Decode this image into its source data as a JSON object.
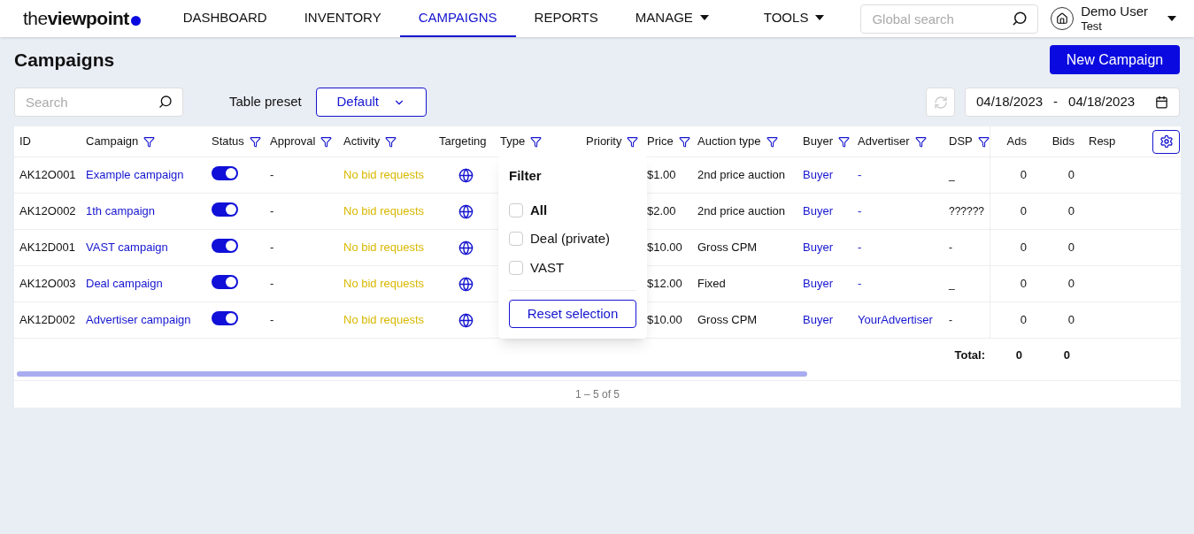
{
  "logo": {
    "light": "the",
    "bold": "viewpoint"
  },
  "nav": [
    {
      "label": "DASHBOARD",
      "selected": false,
      "has_menu": false
    },
    {
      "label": "INVENTORY",
      "selected": false,
      "has_menu": false
    },
    {
      "label": "CAMPAIGNS",
      "selected": true,
      "has_menu": false
    },
    {
      "label": "REPORTS",
      "selected": false,
      "has_menu": false
    },
    {
      "label": "MANAGE",
      "selected": false,
      "has_menu": true
    },
    {
      "label": "TOOLS",
      "selected": false,
      "has_menu": true
    }
  ],
  "global_search": {
    "placeholder": "Global search"
  },
  "user": {
    "name": "Demo User",
    "account": "Test"
  },
  "page_title": "Campaigns",
  "new_button": "New Campaign",
  "search": {
    "placeholder": "Search"
  },
  "preset": {
    "label": "Table preset",
    "value": "Default"
  },
  "date_range": {
    "from": "04/18/2023",
    "separator": "-",
    "to": "04/18/2023"
  },
  "columns": [
    {
      "label": "ID",
      "filter": false
    },
    {
      "label": "Campaign",
      "filter": true
    },
    {
      "label": "Status",
      "filter": true
    },
    {
      "label": "Approval",
      "filter": true
    },
    {
      "label": "Activity",
      "filter": true
    },
    {
      "label": "Targeting",
      "filter": false
    },
    {
      "label": "Type",
      "filter": true
    },
    {
      "label": "Priority",
      "filter": true
    },
    {
      "label": "Price",
      "filter": true
    },
    {
      "label": "Auction type",
      "filter": true
    },
    {
      "label": "Buyer",
      "filter": true
    },
    {
      "label": "Advertiser",
      "filter": true
    },
    {
      "label": "DSP",
      "filter": true
    },
    {
      "label": "Ads",
      "filter": false
    },
    {
      "label": "Bids",
      "filter": false
    },
    {
      "label": "Resp",
      "filter": false
    }
  ],
  "rows": [
    {
      "id": "AK12O001",
      "campaign": "Example campaign",
      "on": true,
      "approval": "-",
      "activity": "No bid requests",
      "price": "$1.00",
      "auction_type": "2nd price auction",
      "buyer": "Buyer",
      "advertiser": "-",
      "dsp": "_",
      "ads": "0",
      "bids": "0"
    },
    {
      "id": "AK12O002",
      "campaign": "1th campaign",
      "on": true,
      "approval": "-",
      "activity": "No bid requests",
      "price": "$2.00",
      "auction_type": "2nd price auction",
      "buyer": "Buyer",
      "advertiser": "-",
      "dsp": "??????",
      "ads": "0",
      "bids": "0"
    },
    {
      "id": "AK12D001",
      "campaign": "VAST campaign",
      "on": true,
      "approval": "-",
      "activity": "No bid requests",
      "price": "$10.00",
      "auction_type": "Gross CPM",
      "buyer": "Buyer",
      "advertiser": "-",
      "dsp": "-",
      "ads": "0",
      "bids": "0"
    },
    {
      "id": "AK12O003",
      "campaign": "Deal campaign",
      "on": true,
      "approval": "-",
      "activity": "No bid requests",
      "price": "$12.00",
      "auction_type": "Fixed",
      "buyer": "Buyer",
      "advertiser": "-",
      "dsp": "_",
      "ads": "0",
      "bids": "0"
    },
    {
      "id": "AK12D002",
      "campaign": "Advertiser campaign",
      "on": true,
      "approval": "-",
      "activity": "No bid requests",
      "price": "$10.00",
      "auction_type": "Gross CPM",
      "buyer": "Buyer",
      "advertiser": "YourAdvertiser",
      "dsp": "-",
      "ads": "0",
      "bids": "0"
    }
  ],
  "totals": {
    "label": "Total:",
    "ads": "0",
    "bids": "0"
  },
  "pagination": "1 – 5 of 5",
  "filter_popup": {
    "title": "Filter",
    "options": [
      {
        "label": "All",
        "checked": false,
        "bold": true
      },
      {
        "label": "Deal (private)",
        "checked": false,
        "bold": false
      },
      {
        "label": "VAST",
        "checked": false,
        "bold": false
      }
    ],
    "reset": "Reset selection"
  }
}
